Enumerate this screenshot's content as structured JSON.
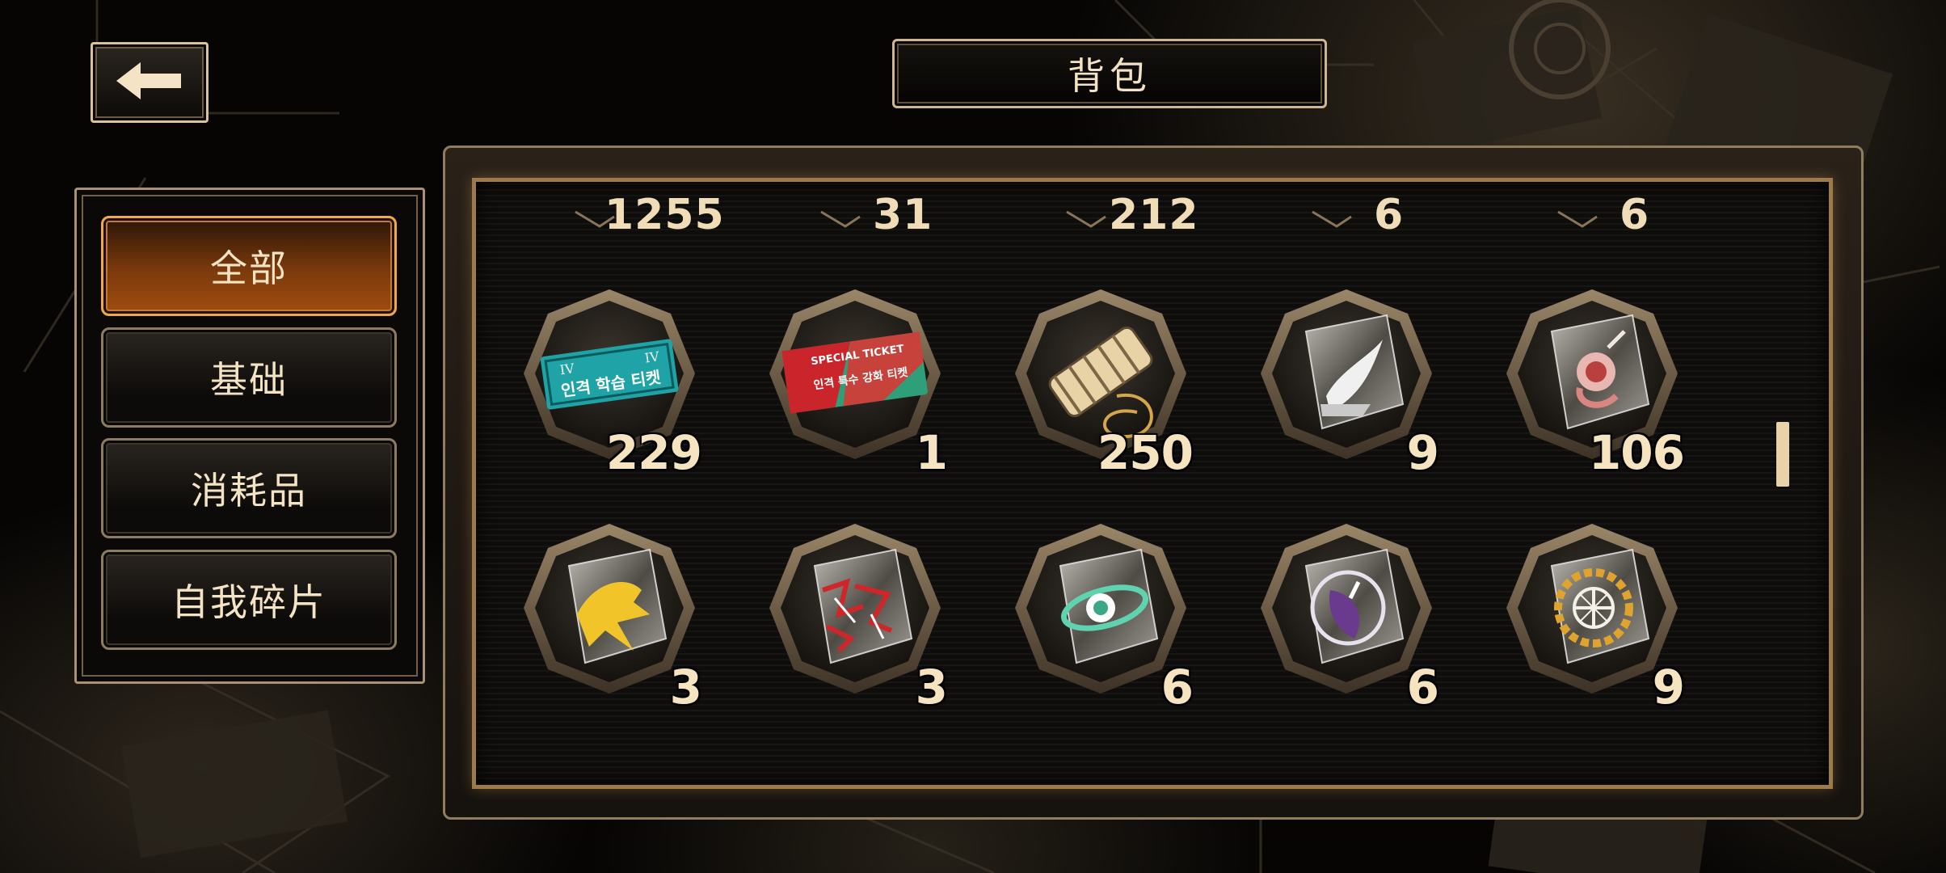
{
  "header": {
    "title": "背包",
    "back_icon": "back-arrow-icon"
  },
  "categories": [
    {
      "label": "全部",
      "active": true
    },
    {
      "label": "基础",
      "active": false
    },
    {
      "label": "消耗品",
      "active": false
    },
    {
      "label": "自我碎片",
      "active": false
    }
  ],
  "partial_row_counts": [
    "1255",
    "31",
    "212",
    "6",
    "6"
  ],
  "items": [
    {
      "icon": "personality-learning-ticket-icon",
      "count": "229",
      "ticket_text": "인격 학습 티켓"
    },
    {
      "icon": "special-ticket-icon",
      "count": "1",
      "ticket_header": "SPECIAL TICKET",
      "ticket_text": "인격 특수 강화 티켓"
    },
    {
      "icon": "bandage-roll-icon",
      "count": "250"
    },
    {
      "icon": "winged-boot-shard-icon",
      "count": "9"
    },
    {
      "icon": "rose-shard-icon",
      "count": "106"
    },
    {
      "icon": "golden-horse-shard-icon",
      "count": "3"
    },
    {
      "icon": "red-script-shard-icon",
      "count": "3"
    },
    {
      "icon": "green-eye-shard-icon",
      "count": "6"
    },
    {
      "icon": "purple-moon-shard-icon",
      "count": "6"
    },
    {
      "icon": "compass-wreath-shard-icon",
      "count": "9"
    }
  ],
  "colors": {
    "accent": "#f0a94a",
    "text": "#f4e3c4",
    "frame": "#9c7a4a"
  }
}
